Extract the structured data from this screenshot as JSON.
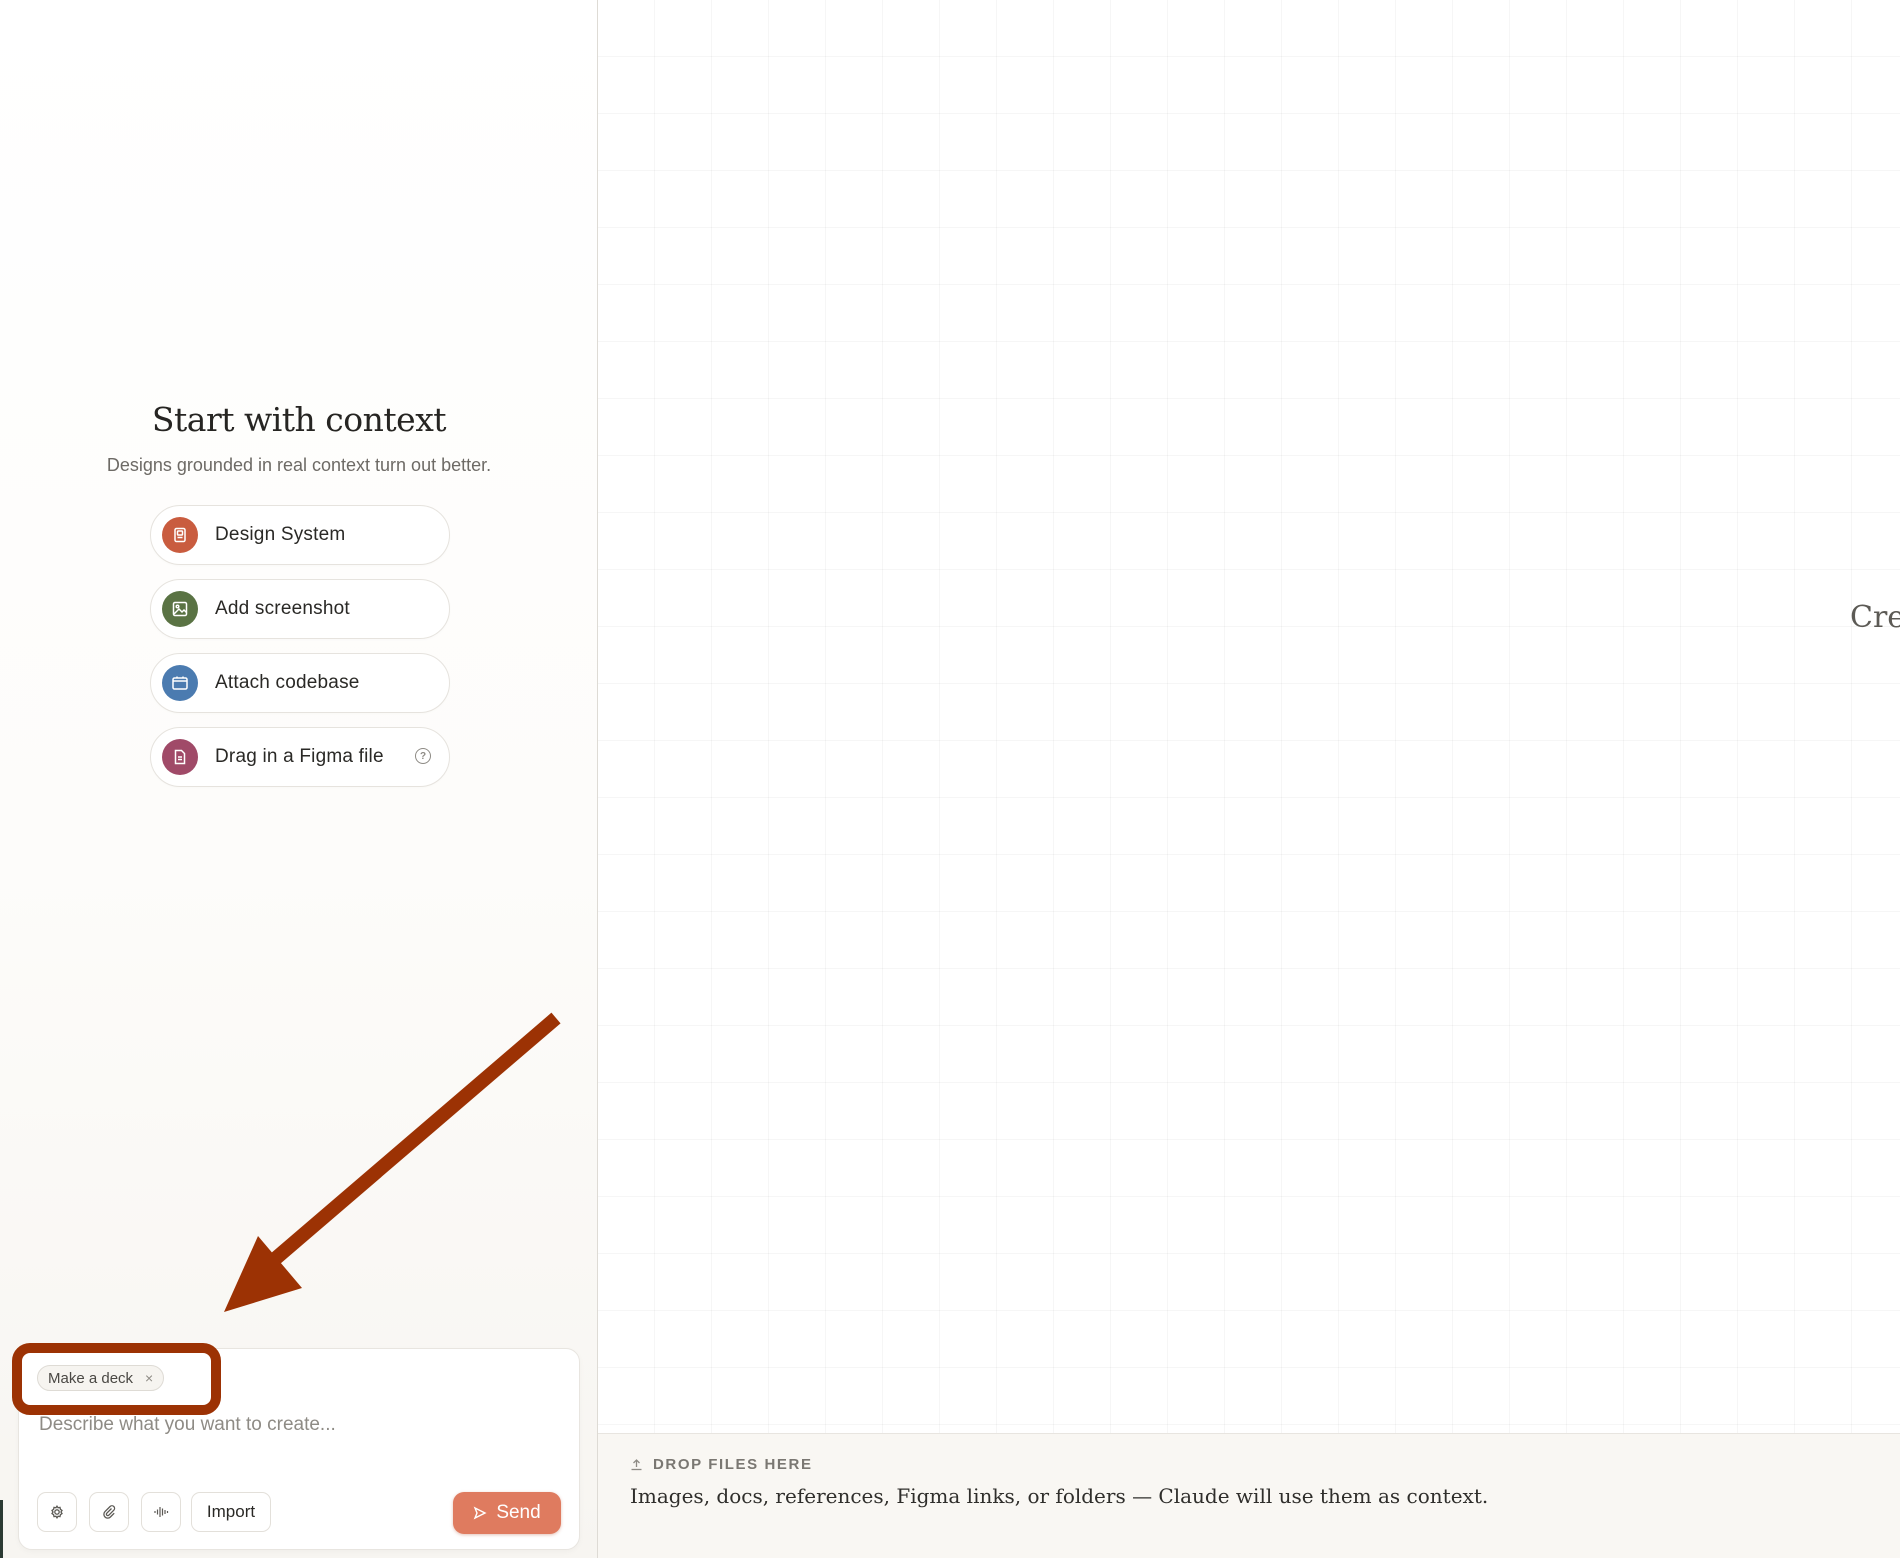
{
  "context": {
    "title": "Start with context",
    "subtitle": "Designs grounded in real context turn out better.",
    "options": [
      {
        "label": "Design System",
        "icon": "design-system-icon",
        "color": "#c95c3f"
      },
      {
        "label": "Add screenshot",
        "icon": "image-icon",
        "color": "#5a7344"
      },
      {
        "label": "Attach codebase",
        "icon": "folder-code-icon",
        "color": "#4b7bb0"
      },
      {
        "label": "Drag in a Figma file",
        "icon": "file-icon",
        "color": "#a04a68",
        "help": "?"
      }
    ]
  },
  "composer": {
    "chip_label": "Make a deck",
    "chip_close": "×",
    "placeholder": "Describe what you want to create...",
    "import_label": "Import",
    "send_label": "Send",
    "tools": [
      "settings-icon",
      "paperclip-icon",
      "waveform-icon"
    ]
  },
  "canvas": {
    "partial_text": "Cre"
  },
  "dropzone": {
    "label": "DROP FILES HERE",
    "description": "Images, docs, references, Figma links, or folders — Claude will use them as context."
  },
  "colors": {
    "accent": "#df7b5f",
    "annotation": "#9c3204"
  }
}
